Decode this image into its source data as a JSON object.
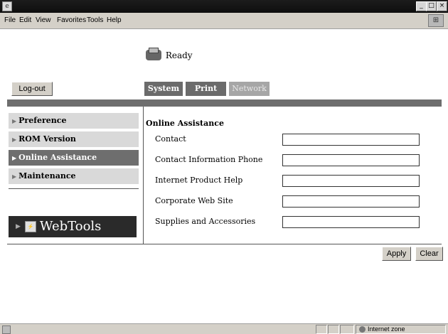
{
  "window": {
    "min_glyph": "_",
    "max_glyph": "□",
    "close_glyph": "×"
  },
  "menu": [
    "File",
    "Edit",
    "View",
    "Favorites",
    "Tools",
    "Help"
  ],
  "status": {
    "text": "Ready"
  },
  "logout_label": "Log-out",
  "tabs": [
    {
      "label": "System",
      "state": "selected"
    },
    {
      "label": "Print",
      "state": "normal"
    },
    {
      "label": "Network",
      "state": "disabled"
    }
  ],
  "sidebar": {
    "items": [
      {
        "label": "Preference",
        "active": false
      },
      {
        "label": "ROM Version",
        "active": false
      },
      {
        "label": "Online Assistance",
        "active": true
      },
      {
        "label": "Maintenance",
        "active": false
      }
    ],
    "webtools_label": "WebTools"
  },
  "form": {
    "title": "Online Assistance",
    "rows": [
      {
        "label": "Contact",
        "value": ""
      },
      {
        "label": "Contact Information Phone",
        "value": ""
      },
      {
        "label": "Internet Product Help",
        "value": ""
      },
      {
        "label": "Corporate Web Site",
        "value": ""
      },
      {
        "label": "Supplies and Accessories",
        "value": ""
      }
    ]
  },
  "buttons": {
    "apply": "Apply",
    "clear": "Clear"
  },
  "statusbar": {
    "zone": "Internet zone"
  },
  "colors": {
    "active": "#6e6e6e",
    "inactive": "#d9d9d9",
    "webtools_bg": "#2a2a2a"
  }
}
